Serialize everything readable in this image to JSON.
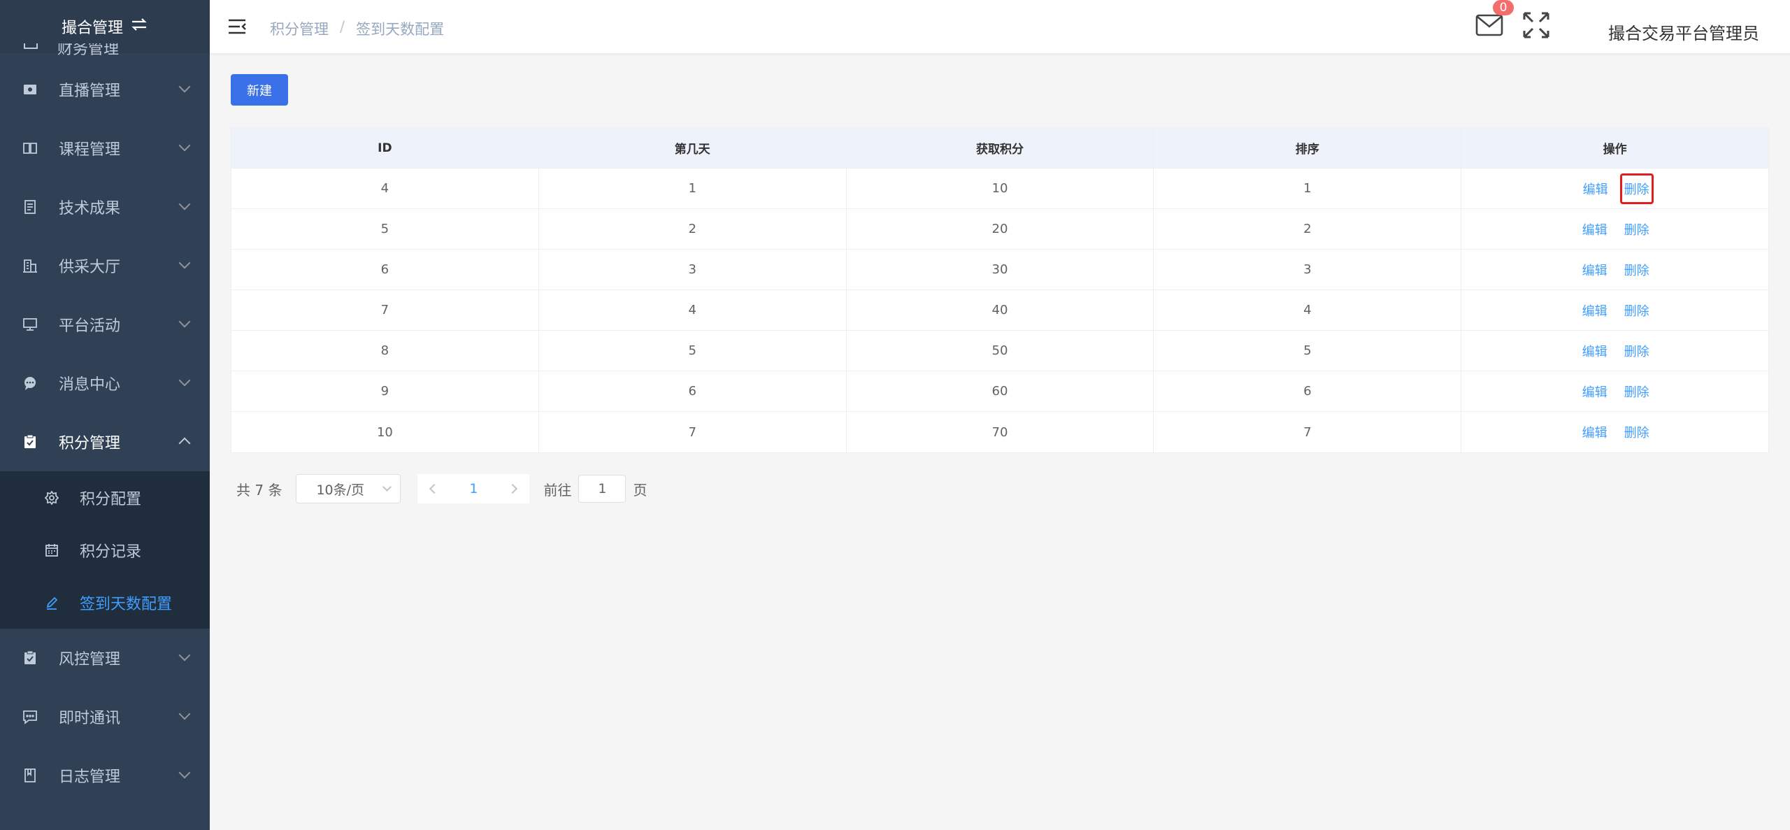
{
  "sidebar": {
    "brand": "撮合管理",
    "cut_item": "财务管理",
    "items": [
      {
        "label": "直播管理",
        "icon": "live-icon"
      },
      {
        "label": "课程管理",
        "icon": "book-icon"
      },
      {
        "label": "技术成果",
        "icon": "document-icon"
      },
      {
        "label": "供采大厅",
        "icon": "building-icon"
      },
      {
        "label": "平台活动",
        "icon": "monitor-icon"
      },
      {
        "label": "消息中心",
        "icon": "chat-icon"
      },
      {
        "label": "积分管理",
        "icon": "clipboard-icon",
        "open": true
      }
    ],
    "submenu": [
      {
        "label": "积分配置",
        "icon": "gear-icon"
      },
      {
        "label": "积分记录",
        "icon": "calendar-icon"
      },
      {
        "label": "签到天数配置",
        "icon": "pen-icon",
        "active": true
      }
    ],
    "items_after": [
      {
        "label": "风控管理",
        "icon": "clipboard-icon"
      },
      {
        "label": "即时通讯",
        "icon": "message-icon"
      },
      {
        "label": "日志管理",
        "icon": "log-icon"
      }
    ]
  },
  "header": {
    "breadcrumb": [
      "积分管理",
      "签到天数配置"
    ],
    "mail_badge": "0",
    "username": "撮合交易平台管理员"
  },
  "toolbar": {
    "new_label": "新建"
  },
  "table": {
    "columns": [
      "ID",
      "第几天",
      "获取积分",
      "排序",
      "操作"
    ],
    "rows": [
      {
        "id": "4",
        "day": "1",
        "points": "10",
        "sort": "1"
      },
      {
        "id": "5",
        "day": "2",
        "points": "20",
        "sort": "2"
      },
      {
        "id": "6",
        "day": "3",
        "points": "30",
        "sort": "3"
      },
      {
        "id": "7",
        "day": "4",
        "points": "40",
        "sort": "4"
      },
      {
        "id": "8",
        "day": "5",
        "points": "50",
        "sort": "5"
      },
      {
        "id": "9",
        "day": "6",
        "points": "60",
        "sort": "6"
      },
      {
        "id": "10",
        "day": "7",
        "points": "70",
        "sort": "7"
      }
    ],
    "edit_label": "编辑",
    "delete_label": "删除"
  },
  "pagination": {
    "total": "共 7 条",
    "page_size": "10条/页",
    "current": "1",
    "goto_prefix": "前往",
    "goto_value": "1",
    "goto_suffix": "页"
  }
}
